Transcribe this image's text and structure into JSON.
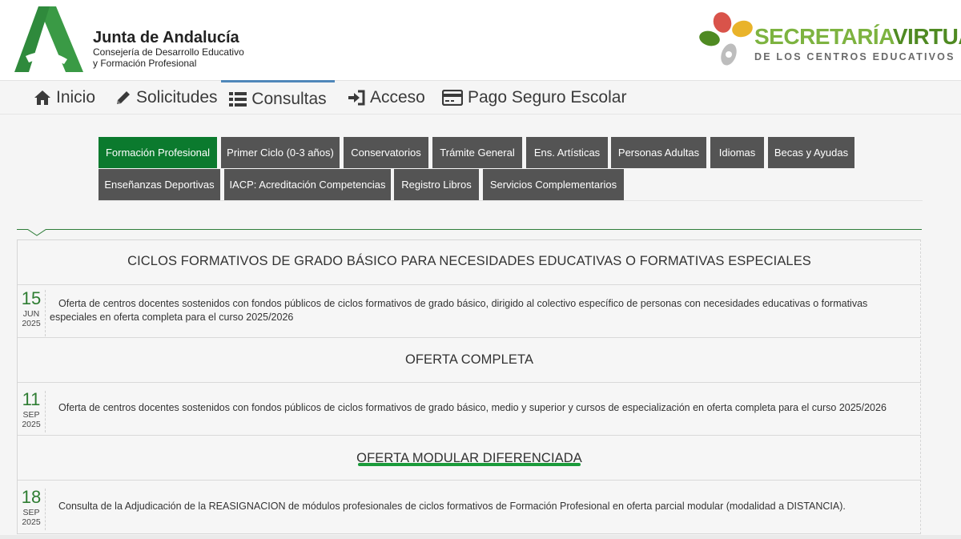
{
  "header": {
    "org_title": "Junta de Andalucía",
    "org_sub1": "Consejería de Desarrollo Educativo",
    "org_sub2": "y Formación Profesional",
    "sv_title_a": "SECRETARÍA",
    "sv_title_b": "VIRTUAL",
    "sv_sub": "DE LOS CENTROS EDUCATIVOS"
  },
  "nav": {
    "items": [
      {
        "label": "Inicio",
        "icon": "home-icon"
      },
      {
        "label": "Solicitudes",
        "icon": "pencil-icon"
      },
      {
        "label": "Consultas",
        "icon": "list-icon"
      },
      {
        "label": "Acceso",
        "icon": "sign-in-icon"
      },
      {
        "label": "Pago Seguro Escolar",
        "icon": "credit-card-icon"
      }
    ],
    "active": "Consultas"
  },
  "tabs": [
    "Formación Profesional",
    "Primer Ciclo (0-3 años)",
    "Conservatorios",
    "Trámite General",
    "Ens. Artísticas",
    "Personas Adultas",
    "Idiomas",
    "Becas y Ayudas",
    "Enseñanzas Deportivas",
    "IACP: Acreditación Competencias",
    "Registro Libros",
    "Servicios Complementarios"
  ],
  "active_tab": "Formación Profesional",
  "sections": [
    {
      "title": "CICLOS FORMATIVOS DE GRADO BÁSICO PARA NECESIDADES EDUCATIVAS O FORMATIVAS ESPECIALES",
      "entries": [
        {
          "day": "15",
          "month": "JUN",
          "year": "2025",
          "text_line1": "Oferta de centros docentes sostenidos con fondos públicos de ciclos formativos de grado básico, dirigido al colectivo específico de personas con necesidades educativas o formativas",
          "text_line2": "especiales en oferta completa para el curso 2025/2026"
        }
      ]
    },
    {
      "title": "OFERTA COMPLETA",
      "entries": [
        {
          "day": "11",
          "month": "SEP",
          "year": "2025",
          "text": "Oferta de centros docentes sostenidos con fondos públicos de ciclos formativos de grado básico, medio y superior y cursos de especialización en oferta completa para el curso 2025/2026"
        }
      ]
    },
    {
      "title": "OFERTA MODULAR DIFERENCIADA",
      "entries": [
        {
          "day": "18",
          "month": "SEP",
          "year": "2025",
          "text": "Consulta de la Adjudicación de la REASIGNACION de módulos profesionales de ciclos formativos de Formación Profesional en oferta parcial modular (modalidad a DISTANCIA)."
        }
      ]
    }
  ],
  "colors": {
    "active_tab": "#0b7a2e",
    "tab": "#545454",
    "date_number": "#2e7d32",
    "sv_light_green": "#7db340",
    "sv_dark_green": "#4f8a22",
    "nav_active_border": "#4f87b9"
  }
}
